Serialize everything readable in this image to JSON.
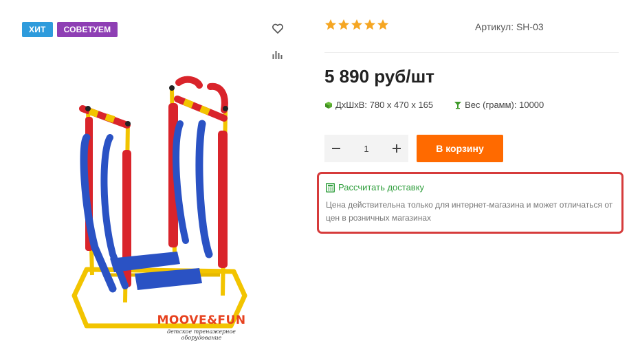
{
  "badges": {
    "hit": "ХИТ",
    "recommend": "СОВЕТУЕМ"
  },
  "icons": {
    "favorite": "heart-icon",
    "compare": "bar-chart-icon",
    "dimensions": "cube-icon",
    "weight": "scale-icon",
    "calculator": "calculator-icon"
  },
  "rating": {
    "value": 5,
    "max": 5
  },
  "sku": "Артикул: SH-03",
  "price": "5 890 руб/шт",
  "props": {
    "dimensions": "ДхШхВ: 780 x 470 x 165",
    "weight": "Вес (грамм): 10000"
  },
  "quantity": {
    "value": "1"
  },
  "cart": {
    "label": "В корзину"
  },
  "delivery": {
    "link": "Рассчитать доставку",
    "note": "Цена действительна только для интернет-магазина и может отличаться от цен в розничных магазинах"
  },
  "brand": {
    "logo": "MOOVE&FUN",
    "tagline": "детское тренажерное оборудование"
  },
  "colors": {
    "accent": "#ff6a00",
    "hit": "#2e9bdc",
    "recommend": "#8e3fb4",
    "star": "#f5a623",
    "link": "#2f9e3c",
    "highlight": "#d63b3b"
  }
}
